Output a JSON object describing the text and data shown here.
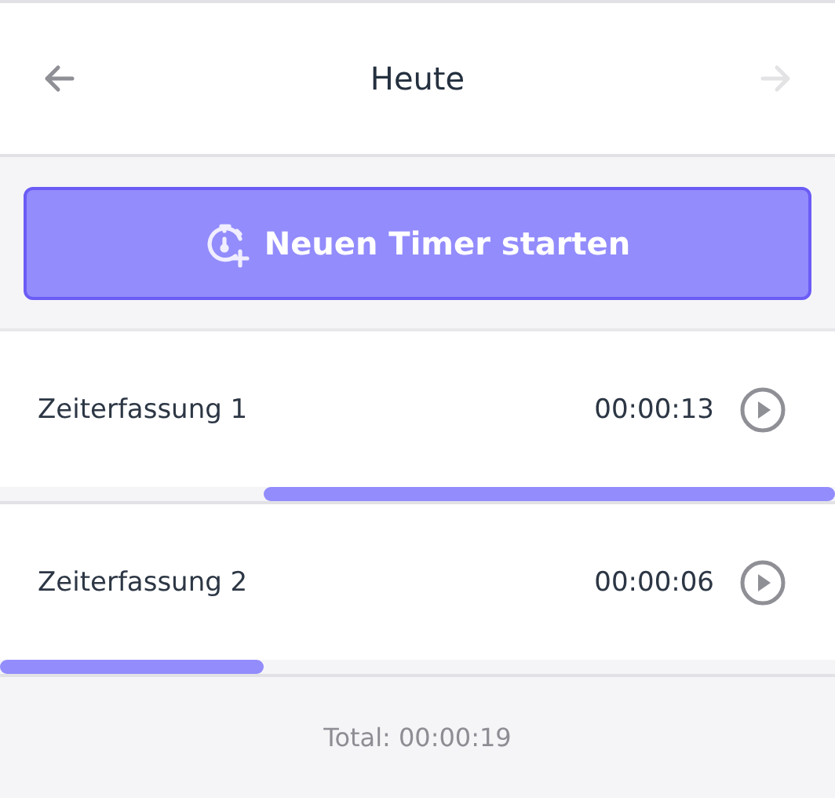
{
  "header": {
    "title": "Heute",
    "back": {
      "disabled": false
    },
    "forward": {
      "disabled": true
    }
  },
  "start_button": {
    "label": "Neuen Timer starten"
  },
  "entries": [
    {
      "name": "Zeiterfassung 1",
      "duration": "00:00:13",
      "level": 0.684
    },
    {
      "name": "Zeiterfassung 2",
      "duration": "00:00:06",
      "level": 0.316
    }
  ],
  "footer": {
    "total": "Total: 00:00:19"
  }
}
